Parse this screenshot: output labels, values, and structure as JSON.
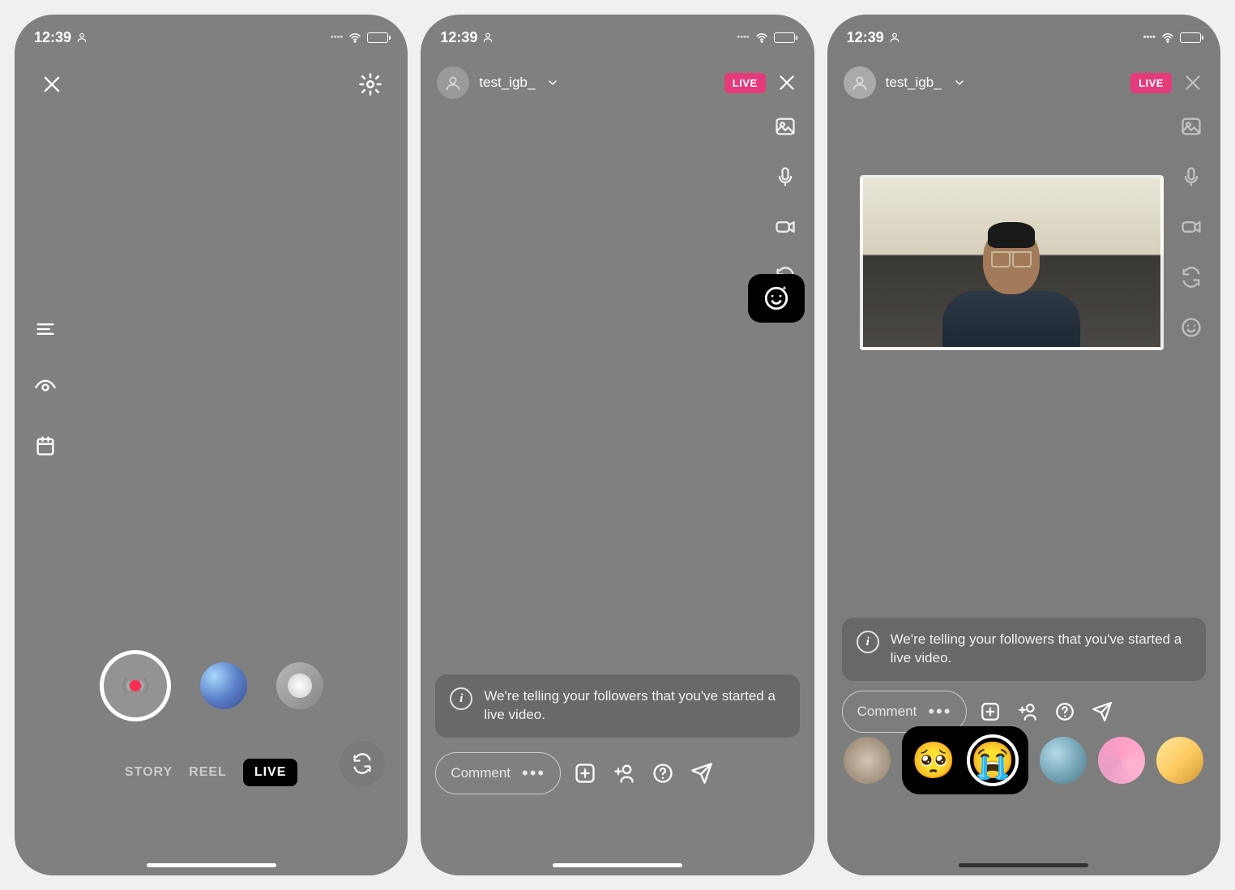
{
  "status": {
    "time": "12:39"
  },
  "screen1": {
    "modes": {
      "story": "STORY",
      "reel": "REEL",
      "live": "LIVE"
    }
  },
  "screen2": {
    "username": "test_igb_",
    "live_badge": "LIVE",
    "info_text": "We're telling your followers that you've started a live video.",
    "comment_placeholder": "Comment"
  },
  "screen3": {
    "username": "test_igb_",
    "live_badge": "LIVE",
    "info_text": "We're telling your followers that you've started a live video.",
    "comment_placeholder": "Comment",
    "emoji_pleading": "🥺",
    "emoji_crying": "😭"
  }
}
